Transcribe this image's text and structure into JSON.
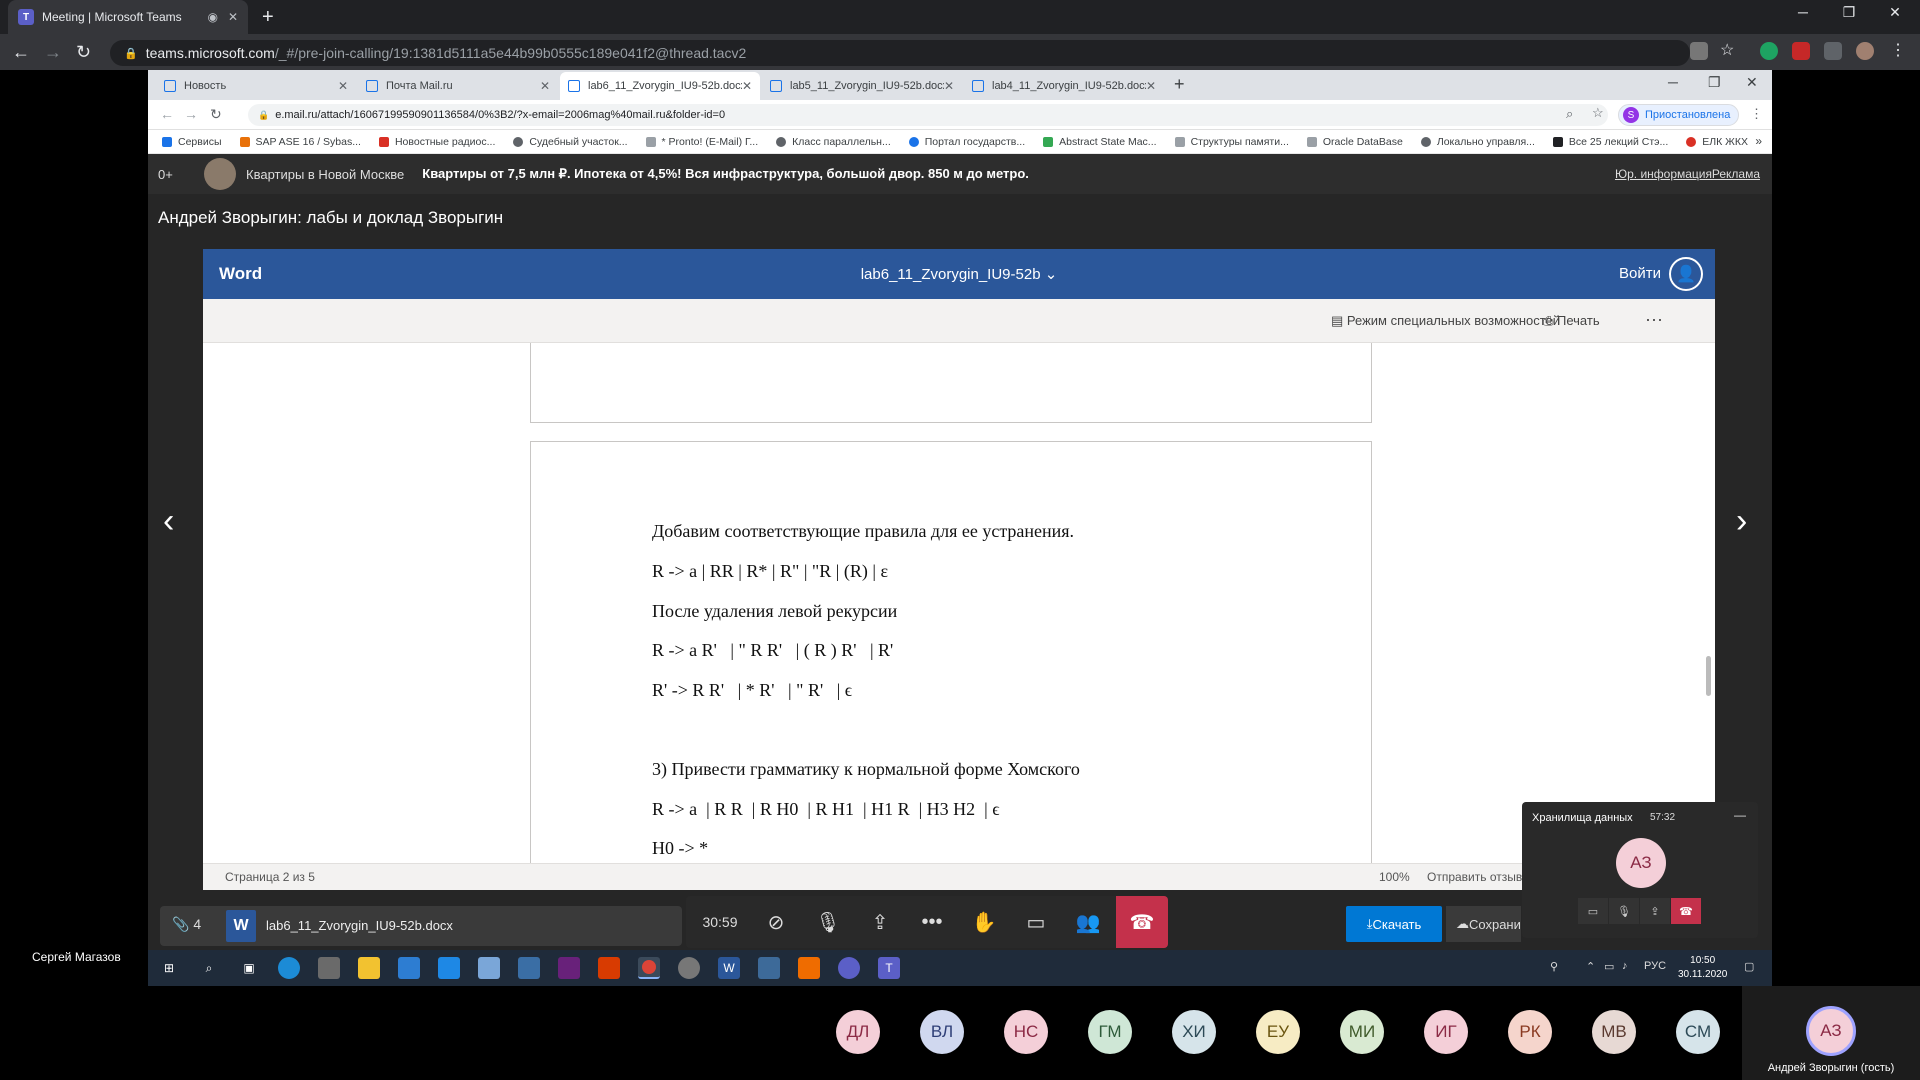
{
  "outer_browser": {
    "tab_title": "Meeting | Microsoft Teams",
    "url_host": "teams.microsoft.com",
    "url_path": "/_#/pre-join-calling/19:1381d5111a5e44b99b0555c189e041f2@thread.tacv2"
  },
  "inner_browser": {
    "tabs": [
      {
        "label": "Новость"
      },
      {
        "label": "Почта Mail.ru"
      },
      {
        "label": "lab6_11_Zvorygin_IU9-52b.docx"
      },
      {
        "label": "lab5_11_Zvorygin_IU9-52b.docx"
      },
      {
        "label": "lab4_11_Zvorygin_IU9-52b.docx"
      }
    ],
    "url": "e.mail.ru/attach/16067199590901136584/0%3B2/?x-email=2006mag%40mail.ru&folder-id=0",
    "profile_status": "Приостановлена",
    "profile_initial": "S",
    "bookmarks": [
      "Сервисы",
      "SAP ASE 16 / Sybas...",
      "Новостные радиос...",
      "Судебный участок...",
      "* Pronto! (E-Mail) Г...",
      "Класс параллельн...",
      "Портал государств...",
      "Abstract State Mac...",
      "Структуры памяти...",
      "Oracle DataBase",
      "Локально управля...",
      "Все 25 лекций Стэ...",
      "ЕЛК ЖКХ"
    ]
  },
  "ad": {
    "age": "0+",
    "title": "Квартиры в Новой Москве",
    "text": "Квартиры от 7,5 млн ₽. Ипотека от 4,5%! Вся инфраструктура, большой двор. 850 м до метро.",
    "legal_link": "Юр. информация",
    "ad_link": "Реклама"
  },
  "viewer": {
    "title": "Андрей Зворыгин: лабы и доклад Зворыгин"
  },
  "word": {
    "brand": "Word",
    "doc_name": "lab6_11_Zvorygin_IU9-52b",
    "login": "Войти",
    "accessibility": "Режим специальных возможностей",
    "print": "Печать",
    "more": "···",
    "lines": [
      "Добавим соответствующие правила для ее устранения.",
      "R -> a | RR | R* | R\" | \"R | (R) | ε",
      "После удаления левой рекурсии",
      "R -> a R'   | \" R R'   | ( R ) R'   | R'",
      "R' -> R R'   | * R'   | \" R'   | ϵ",
      "3) Привести грамматику к нормальной форме Хомского",
      "R -> a  | R R  | R H0  | R H1  | H1 R  | H3 H2  | ϵ",
      "H0 -> *"
    ],
    "status_page": "Страница 2 из 5",
    "zoom": "100%",
    "feedback": "Отправить отзыв"
  },
  "attachment": {
    "count": "4",
    "file_name": "lab6_11_Zvorygin_IU9-52b.docx",
    "download": "Скачать",
    "save": "Сохранить"
  },
  "meeting": {
    "timer": "30:59"
  },
  "pip": {
    "title": "Хранилища данных",
    "time": "57:32",
    "initials": "АЗ"
  },
  "presenter_label": "Сергей Магазов",
  "taskbar": {
    "lang": "РУС",
    "time": "10:50",
    "date": "30.11.2020"
  },
  "participants": [
    {
      "initials": "ДЛ",
      "bg": "#f4cfd8",
      "fg": "#8b2a45"
    },
    {
      "initials": "ВЛ",
      "bg": "#d0d8ef",
      "fg": "#2f3f77"
    },
    {
      "initials": "НС",
      "bg": "#f4cfd8",
      "fg": "#8b2a45"
    },
    {
      "initials": "ГМ",
      "bg": "#cfe7d6",
      "fg": "#2e5b3a"
    },
    {
      "initials": "ХИ",
      "bg": "#d6e4ea",
      "fg": "#2d4a57"
    },
    {
      "initials": "ЕУ",
      "bg": "#f7ecc4",
      "fg": "#6b5510"
    },
    {
      "initials": "МИ",
      "bg": "#d9ead2",
      "fg": "#3f5a2a"
    },
    {
      "initials": "ИГ",
      "bg": "#f4cfd8",
      "fg": "#8b2a45"
    },
    {
      "initials": "РК",
      "bg": "#f5d5cc",
      "fg": "#8a3a22"
    },
    {
      "initials": "МВ",
      "bg": "#e7d9d4",
      "fg": "#5b3a30"
    },
    {
      "initials": "СМ",
      "bg": "#d6e4ea",
      "fg": "#2d4a57"
    }
  ],
  "self": {
    "initials": "АЗ",
    "name": "Андрей Зворыгин (гость)"
  }
}
